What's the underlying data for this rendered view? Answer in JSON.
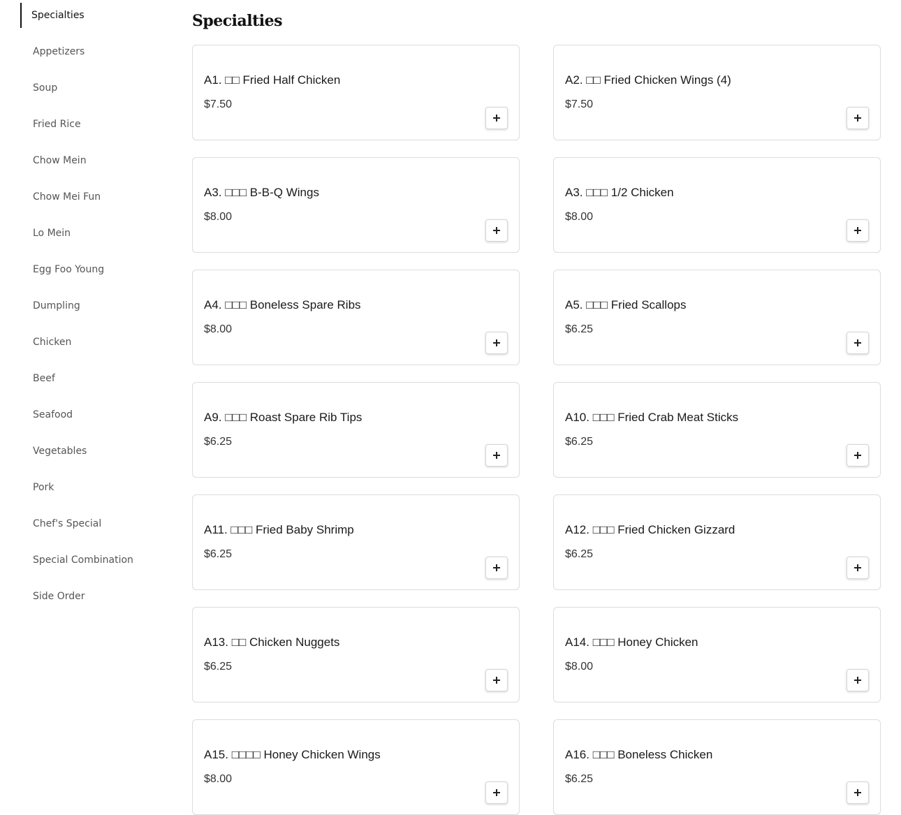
{
  "sidebar": {
    "items": [
      {
        "label": "Specialties",
        "active": true
      },
      {
        "label": "Appetizers"
      },
      {
        "label": "Soup"
      },
      {
        "label": "Fried Rice"
      },
      {
        "label": "Chow Mein"
      },
      {
        "label": "Chow Mei Fun"
      },
      {
        "label": "Lo Mein"
      },
      {
        "label": "Egg Foo Young"
      },
      {
        "label": "Dumpling"
      },
      {
        "label": "Chicken"
      },
      {
        "label": "Beef"
      },
      {
        "label": "Seafood"
      },
      {
        "label": "Vegetables"
      },
      {
        "label": "Pork"
      },
      {
        "label": "Chef's Special"
      },
      {
        "label": "Special Combination"
      },
      {
        "label": "Side Order"
      }
    ]
  },
  "main": {
    "section_title": "Specialties",
    "items": [
      {
        "name": "A1. □□ Fried Half Chicken",
        "price": "$7.50"
      },
      {
        "name": "A2. □□ Fried Chicken Wings (4)",
        "price": "$7.50"
      },
      {
        "name": "A3. □□□ B-B-Q Wings",
        "price": "$8.00"
      },
      {
        "name": "A3. □□□ 1/2 Chicken",
        "price": "$8.00"
      },
      {
        "name": "A4. □□□ Boneless Spare Ribs",
        "price": "$8.00"
      },
      {
        "name": "A5. □□□ Fried Scallops",
        "price": "$6.25"
      },
      {
        "name": "A9. □□□ Roast Spare Rib Tips",
        "price": "$6.25"
      },
      {
        "name": "A10. □□□ Fried Crab Meat Sticks",
        "price": "$6.25"
      },
      {
        "name": "A11. □□□ Fried Baby Shrimp",
        "price": "$6.25"
      },
      {
        "name": "A12. □□□ Fried Chicken Gizzard",
        "price": "$6.25"
      },
      {
        "name": "A13. □□ Chicken Nuggets",
        "price": "$6.25"
      },
      {
        "name": "A14. □□□ Honey Chicken",
        "price": "$8.00"
      },
      {
        "name": "A15. □□□□ Honey Chicken Wings",
        "price": "$8.00"
      },
      {
        "name": "A16. □□□ Boneless Chicken",
        "price": "$6.25"
      }
    ]
  }
}
